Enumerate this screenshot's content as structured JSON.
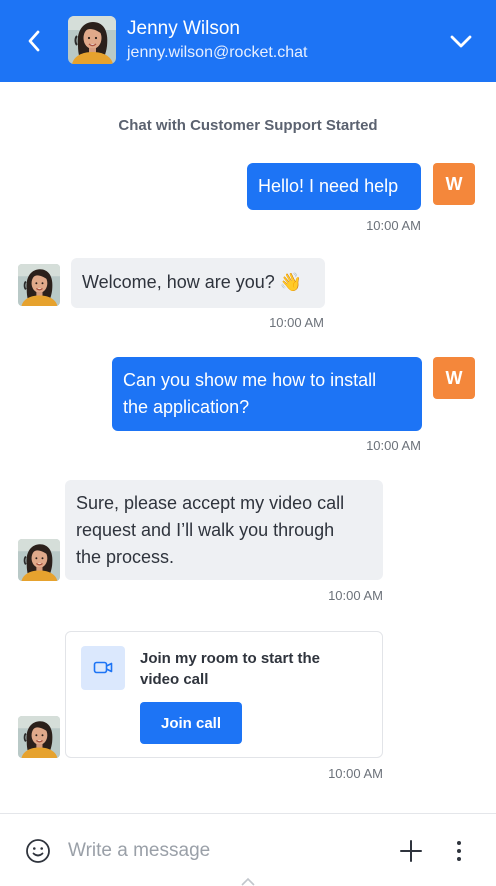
{
  "header": {
    "name": "Jenny Wilson",
    "email": "jenny.wilson@rocket.chat",
    "back_icon": "chevron-left-icon",
    "expand_icon": "chevron-down-icon"
  },
  "system_message": "Chat with Customer Support Started",
  "messages": [
    {
      "text": "Hello! I need help",
      "time": "10:00 AM",
      "avatar_initial": "W"
    },
    {
      "text": "Welcome, how are you? 👋",
      "time": "10:00 AM"
    },
    {
      "line1": "Can you show me how to install",
      "line2": "the application?",
      "time": "10:00 AM",
      "avatar_initial": "W"
    },
    {
      "line1": "Sure, please accept my video call",
      "line2": "request and I’ll walk you through",
      "line3": "the process.",
      "time": "10:00 AM"
    }
  ],
  "video_card": {
    "title": "Join my room to start the video call",
    "button": "Join call",
    "time": "10:00 AM",
    "icon": "video-camera-icon"
  },
  "composer": {
    "placeholder": "Write a message",
    "emoji_icon": "emoji-icon",
    "add_icon": "plus-icon",
    "more_icon": "kebab-menu-icon"
  },
  "colors": {
    "brand": "#1d74f5",
    "avatar_initial_bg": "#f4873b",
    "incoming_bubble": "#eef0f3"
  }
}
